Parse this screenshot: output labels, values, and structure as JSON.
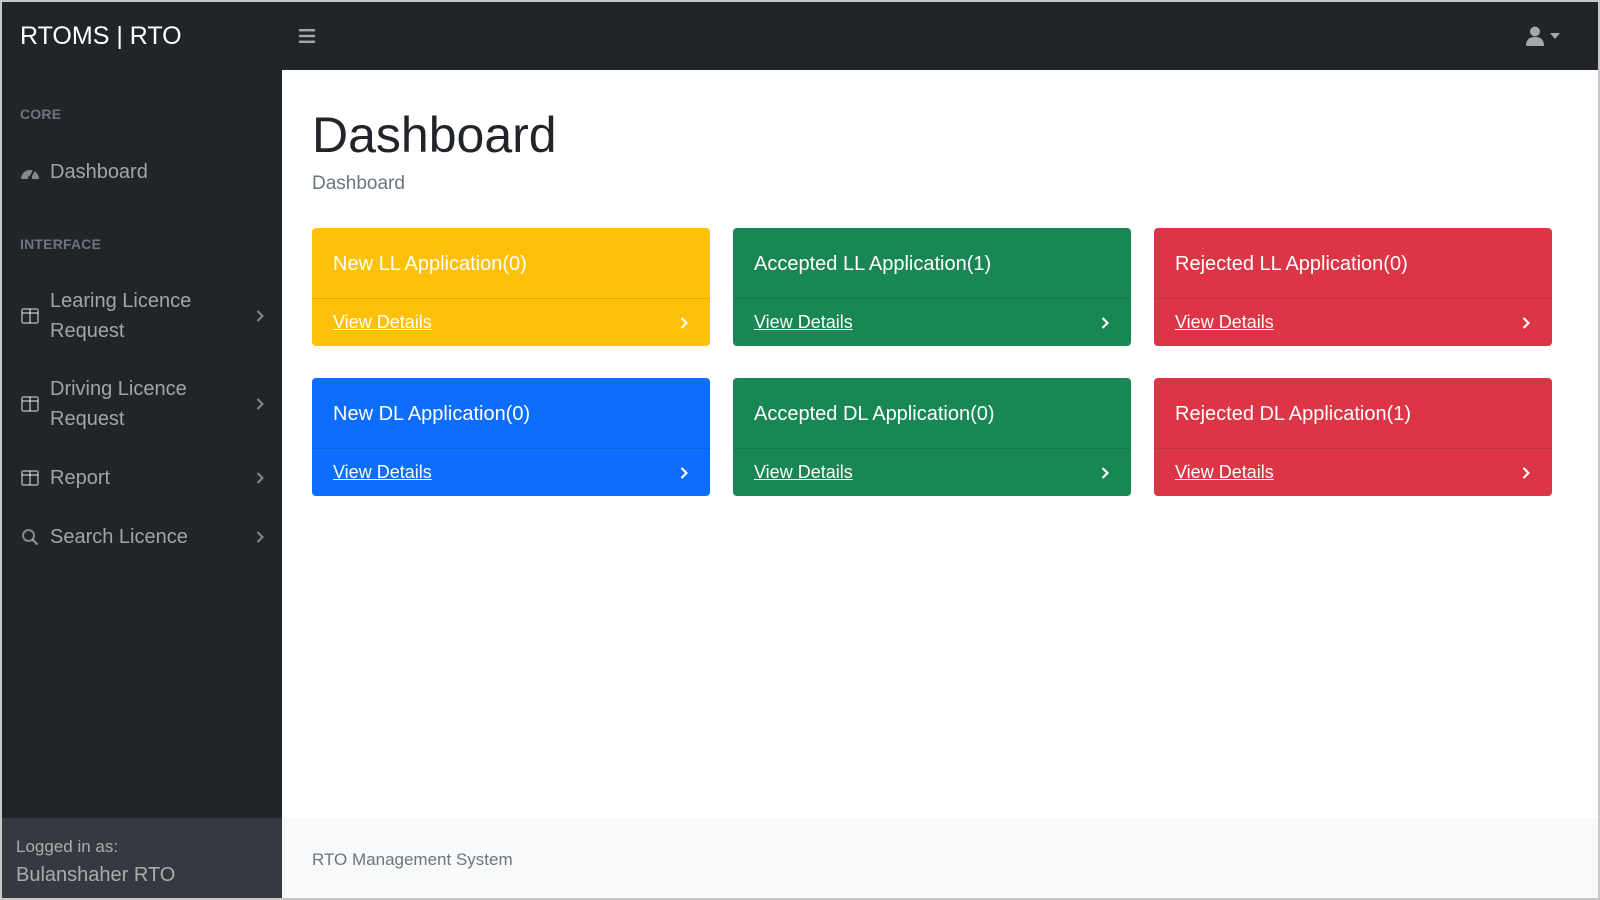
{
  "navbar": {
    "brand": "RTOMS | RTO",
    "toggle_icon": "hamburger-icon",
    "user_icon": "user-icon"
  },
  "sidebar": {
    "core_heading": "CORE",
    "dashboard_label": "Dashboard",
    "interface_heading": "INTERFACE",
    "items": [
      {
        "label": "Learing Licence Request",
        "icon": "columns-icon"
      },
      {
        "label": "Driving Licence Request",
        "icon": "columns-icon"
      },
      {
        "label": "Report",
        "icon": "columns-icon"
      },
      {
        "label": "Search Licence",
        "icon": "search-icon"
      }
    ],
    "footer_small": "Logged in as:",
    "footer_name": "Bulanshaher RTO"
  },
  "main": {
    "title": "Dashboard",
    "breadcrumb": "Dashboard",
    "cards": [
      {
        "title": "New LL Application(0)",
        "link": "View Details",
        "color": "#ffc107"
      },
      {
        "title": "Accepted LL Application(1)",
        "link": "View Details",
        "color": "#198754"
      },
      {
        "title": "Rejected LL Application(0)",
        "link": "View Details",
        "color": "#dc3545"
      },
      {
        "title": "New DL Application(0)",
        "link": "View Details",
        "color": "#0d6efd"
      },
      {
        "title": "Accepted DL Application(0)",
        "link": "View Details",
        "color": "#198754"
      },
      {
        "title": "Rejected DL Application(1)",
        "link": "View Details",
        "color": "#dc3545"
      }
    ]
  },
  "footer": {
    "text": "RTO Management System"
  }
}
